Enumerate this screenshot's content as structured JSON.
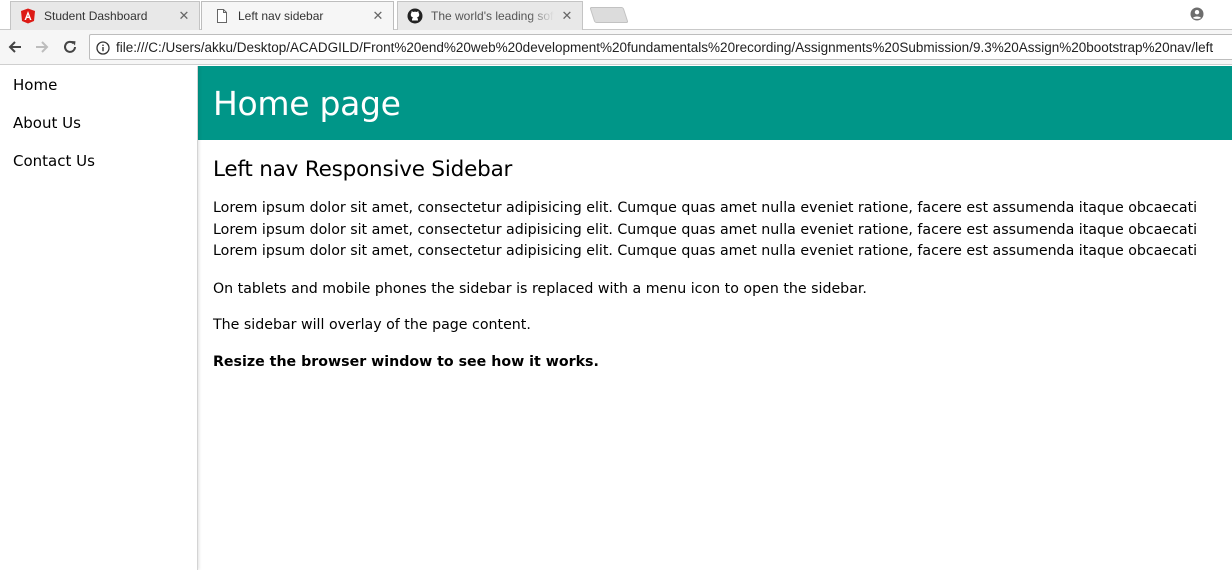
{
  "browser": {
    "tabs": [
      {
        "title": "Student Dashboard",
        "icon": "angular-icon",
        "active": false
      },
      {
        "title": "Left nav sidebar",
        "icon": "page-icon",
        "active": true
      },
      {
        "title": "The world's leading softw",
        "icon": "github-icon",
        "active": false
      }
    ],
    "close_glyph": "✕",
    "url": "file:///C:/Users/akku/Desktop/ACADGILD/Front%20end%20web%20development%20fundamentals%20recording/Assignments%20Submission/9.3%20Assign%20bootstrap%20nav/left"
  },
  "sidebar": {
    "items": [
      {
        "label": "Home"
      },
      {
        "label": "About Us"
      },
      {
        "label": "Contact Us"
      }
    ]
  },
  "header": {
    "title": "Home page",
    "background_color": "#009688"
  },
  "main": {
    "heading": "Left nav Responsive Sidebar",
    "lorem_lines": [
      "Lorem ipsum dolor sit amet, consectetur adipisicing elit. Cumque quas amet nulla eveniet ratione, facere est assumenda itaque obcaecati",
      "Lorem ipsum dolor sit amet, consectetur adipisicing elit. Cumque quas amet nulla eveniet ratione, facere est assumenda itaque obcaecati",
      "Lorem ipsum dolor sit amet, consectetur adipisicing elit. Cumque quas amet nulla eveniet ratione, facere est assumenda itaque obcaecati"
    ],
    "paragraph_tablets": "On tablets and mobile phones the sidebar is replaced with a menu icon to open the sidebar.",
    "paragraph_overlay": "The sidebar will overlay of the page content.",
    "paragraph_resize": "Resize the browser window to see how it works."
  }
}
